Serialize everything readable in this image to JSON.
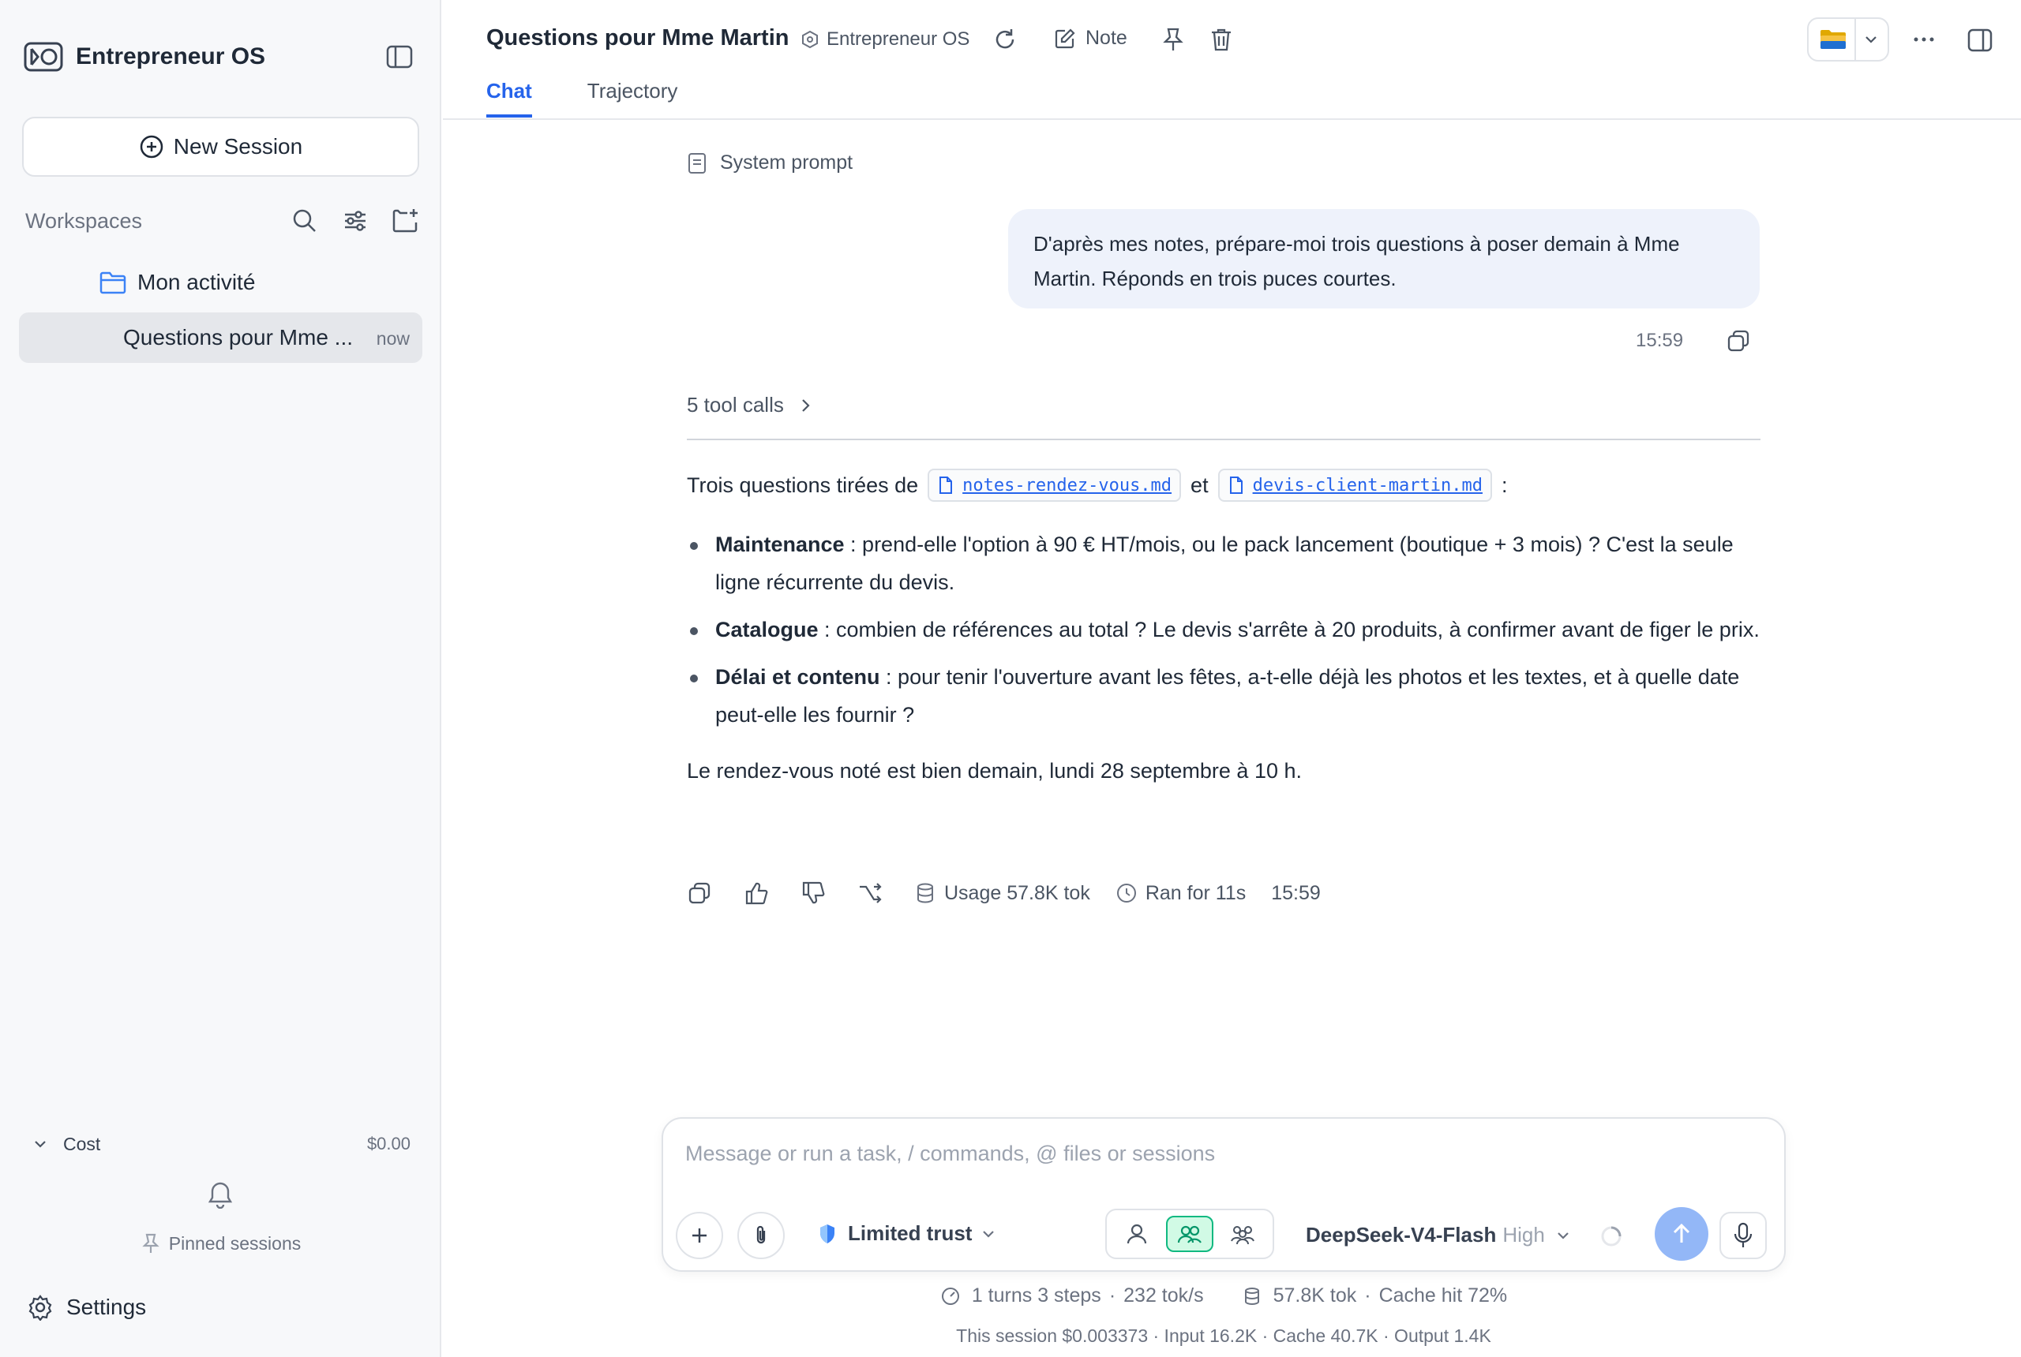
{
  "app": {
    "name": "Entrepreneur OS"
  },
  "sidebar": {
    "new_session": "New Session",
    "workspaces_label": "Workspaces",
    "folder": "Mon activité",
    "session": {
      "title": "Questions pour Mme ...",
      "time": "now"
    },
    "cost": {
      "label": "Cost",
      "value": "$0.00"
    },
    "pinned_label": "Pinned sessions",
    "settings_label": "Settings"
  },
  "header": {
    "title": "Questions pour Mme Martin",
    "workspace": "Entrepreneur OS",
    "note_label": "Note",
    "tabs": [
      {
        "label": "Chat",
        "active": true
      },
      {
        "label": "Trajectory",
        "active": false
      }
    ]
  },
  "chat": {
    "system_prompt_label": "System prompt",
    "user_message": "D'après mes notes, prépare-moi trois questions à poser demain à Mme Martin. Réponds en trois puces courtes.",
    "user_time": "15:59",
    "tool_calls": "5 tool calls",
    "answer": {
      "intro_prefix": "Trois questions tirées de",
      "file1": "notes-rendez-vous.md",
      "joiner": "et",
      "file2": "devis-client-martin.md",
      "intro_suffix": ":",
      "bullets": [
        {
          "title": "Maintenance",
          "text": " : prend-elle l'option à 90 € HT/mois, ou le pack lancement (boutique + 3 mois) ? C'est la seule ligne récurrente du devis."
        },
        {
          "title": "Catalogue",
          "text": " : combien de références au total ? Le devis s'arrête à 20 produits, à confirmer avant de figer le prix."
        },
        {
          "title": "Délai et contenu",
          "text": " : pour tenir l'ouverture avant les fêtes, a-t-elle déjà les photos et les textes, et à quelle date peut-elle les fournir ?"
        }
      ],
      "outro": "Le rendez-vous noté est bien demain, lundi 28 septembre à 10 h."
    },
    "actions": {
      "usage": "Usage 57.8K tok",
      "ran_for": "Ran for 11s",
      "time": "15:59"
    }
  },
  "composer": {
    "placeholder": "Message or run a task, / commands, @ files or sessions",
    "trust_label": "Limited trust",
    "model_name": "DeepSeek-V4-Flash",
    "model_level": "High"
  },
  "stats": {
    "turns": "1 turns 3 steps",
    "speed": "232 tok/s",
    "tokens": "57.8K tok",
    "cache_hit": "Cache hit 72%",
    "session_line": "This session $0.003373 · Input 16.2K · Cache 40.7K · Output 1.4K"
  },
  "colors": {
    "accent": "#2563eb",
    "send": "#93b7f7",
    "mode_active": "#10b981",
    "bubble": "#eef2fb"
  }
}
